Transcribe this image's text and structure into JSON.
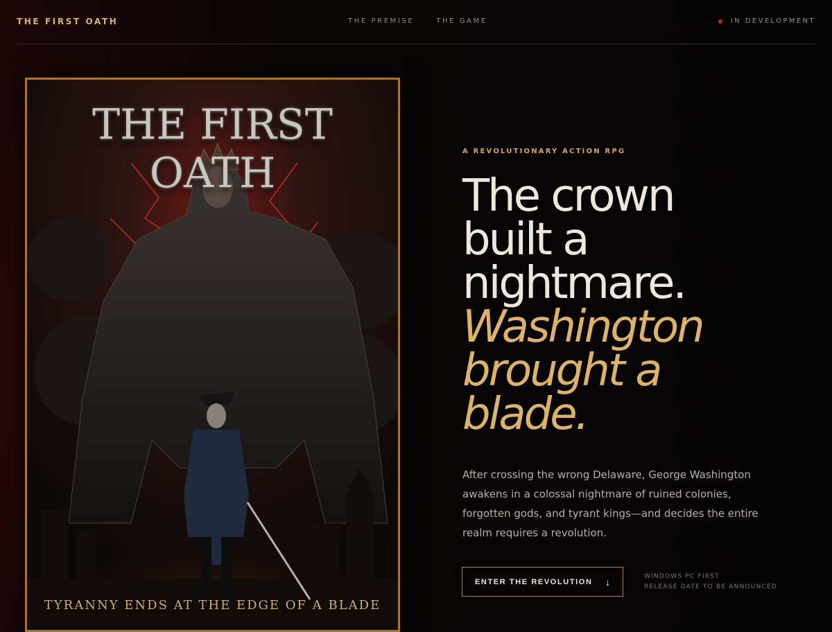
{
  "nav": {
    "brand": "THE FIRST OATH",
    "links": [
      "THE PREMISE",
      "THE GAME"
    ],
    "status": "IN DEVELOPMENT",
    "status_color": "#c8232b"
  },
  "poster": {
    "title": "THE FIRST OATH",
    "tagline": "TYRANNY ENDS AT THE EDGE OF A BLADE"
  },
  "hero": {
    "eyebrow": "A REVOLUTIONARY ACTION RPG",
    "headline_lines": [
      "The crown",
      "built a",
      "nightmare."
    ],
    "headline_gold_lines": [
      "Washington",
      "brought a",
      "blade."
    ],
    "body": "After crossing the wrong Delaware, George Washington awakens in a colossal nightmare of ruined colonies, forgotten gods, and tyrant kings—and decides the entire realm requires a revolution.",
    "cta_label": "ENTER THE REVOLUTION",
    "cta_icon": "arrow-down-icon",
    "meta_lines": [
      "WINDOWS PC FIRST",
      "RELEASE DATE TO BE ANNOUNCED"
    ]
  },
  "colors": {
    "accent_gold": "#ddb26a",
    "text_light": "#efe7dc",
    "background": "#070505"
  }
}
